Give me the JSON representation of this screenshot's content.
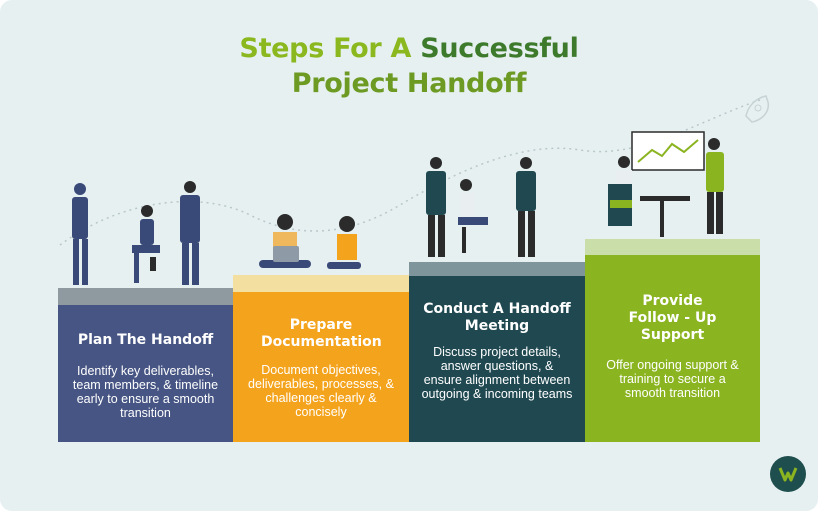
{
  "title": {
    "part1": "Steps For A ",
    "part2": "Successful",
    "line2": "Project Handoff"
  },
  "steps": [
    {
      "title": "Plan The Handoff",
      "desc": "Identify key deliverables, team members, & timeline early to ensure a smooth transition",
      "color": "#465583",
      "cap_color": "#8f9aa0"
    },
    {
      "title": "Prepare Documentation",
      "desc": "Document objectives, deliverables, processes, & challenges clearly & concisely",
      "color": "#f4a31c",
      "cap_color": "#f3dfa0"
    },
    {
      "title": "Conduct A Handoff Meeting",
      "desc": "Discuss project details, answer questions, & ensure alignment between outgoing & incoming teams",
      "color": "#1f4850",
      "cap_color": "#7d959b"
    },
    {
      "title": "Provide Follow - Up Support",
      "desc": "Offer ongoing support & training to secure a smooth transition",
      "color": "#8bb421",
      "cap_color": "#c9dea8"
    }
  ],
  "icons": [
    "team-planning-illustration",
    "documentation-illustration",
    "meeting-illustration",
    "support-illustration",
    "rocket-icon",
    "brand-logo-icon"
  ]
}
